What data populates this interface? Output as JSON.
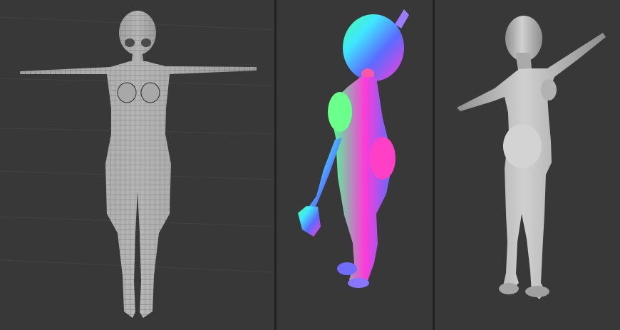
{
  "app": {
    "title": "",
    "viewports": [
      {
        "name": "wireframe-view",
        "shading": "wireframe",
        "colors": {
          "bg": "#383838",
          "model": "#a9a9a9",
          "wire": "#2c2c2c",
          "grid": "#444444"
        }
      },
      {
        "name": "normal-map-view",
        "shading": "normals",
        "colors": {
          "bg": "#383838",
          "magenta": "#ff3bd8",
          "cyan": "#3fe7ff",
          "blue": "#5a6cff",
          "green": "#47ff93"
        }
      },
      {
        "name": "solid-view",
        "shading": "solid",
        "colors": {
          "bg": "#383838",
          "model": "#c9c9c9",
          "shadow": "#8d8d8d"
        }
      }
    ],
    "icons": {
      "divider": "viewport-split"
    }
  }
}
